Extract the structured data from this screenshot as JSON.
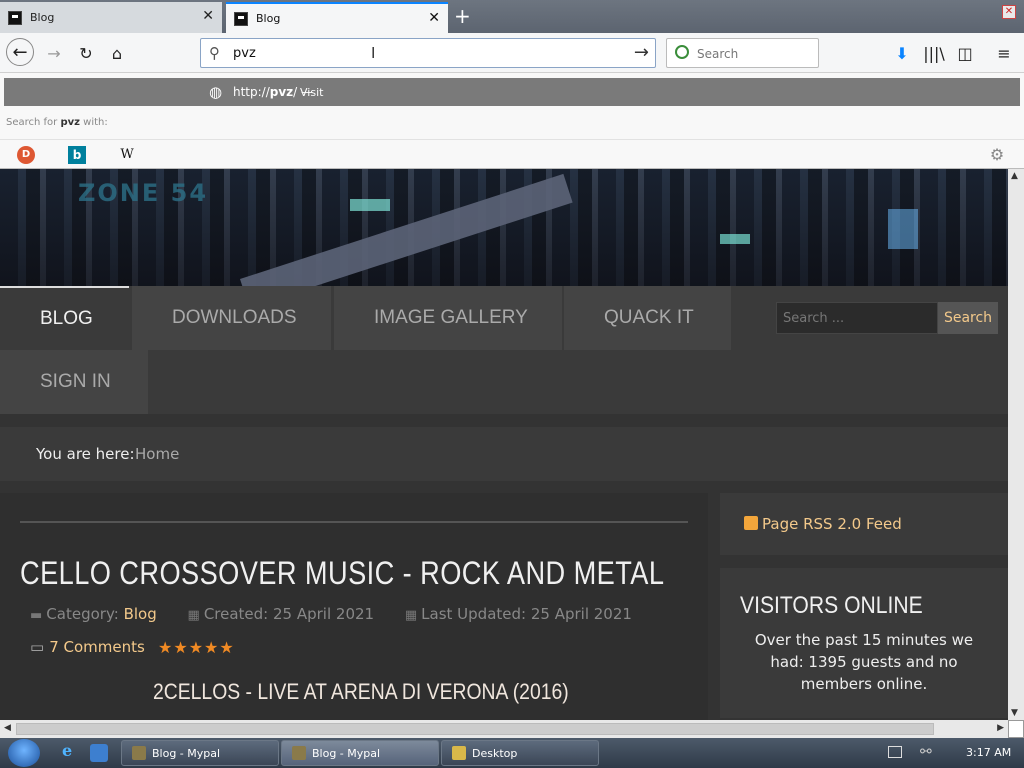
{
  "browser": {
    "tabs": [
      {
        "title": "Blog",
        "close": "✕"
      },
      {
        "title": "Blog",
        "close": "✕"
      }
    ],
    "new_tab": "+",
    "window_close": "✕",
    "nav": {
      "back": "←",
      "forward": "→",
      "reload": "↻",
      "home": "⌂"
    },
    "address": {
      "value": "pvz",
      "go": "→"
    },
    "search": {
      "placeholder": "Search"
    },
    "toolbar": {
      "downloads": "⬇",
      "library": "|||\\",
      "sidebar": "◫",
      "menu": "≡"
    }
  },
  "autocomplete": {
    "visit_url_prefix": "http://",
    "visit_url_host": "pvz",
    "visit_url_suffix": "/",
    "visit_sep": " — ",
    "visit_label": "Visit",
    "search_for_prefix": "Search for",
    "search_term": "pvz",
    "search_for_suffix": "with:",
    "engines": [
      "D",
      "b",
      "W"
    ],
    "settings_icon": "⚙"
  },
  "page": {
    "banner_logo": "ZONE 54",
    "menu": [
      "BLOG",
      "DOWNLOADS",
      "IMAGE GALLERY",
      "QUACK IT",
      "SIGN IN"
    ],
    "site_search_placeholder": "Search ...",
    "site_search_button": "Search",
    "breadcrumb_label": "You are here:",
    "breadcrumb_home": "Home",
    "article": {
      "title": "CELLO CROSSOVER MUSIC - ROCK AND METAL",
      "category_label": "Category:",
      "category": "Blog",
      "created": "Created: 25 April 2021",
      "updated": "Last Updated: 25 April 2021",
      "comments": "7 Comments",
      "rating_stars": 5,
      "subtitle": "2CELLOS - LIVE AT ARENA DI VERONA (2016)"
    },
    "sidebar": {
      "rss": "Page RSS 2.0 Feed",
      "visitors_title": "VISITORS ONLINE",
      "visitors_text": "Over the past 15 minutes we had: 1395 guests and no members online."
    }
  },
  "taskbar": {
    "tasks": [
      "Blog - Mypal",
      "Blog - Mypal",
      "Desktop"
    ],
    "clock": "3:17 AM"
  },
  "colors": {
    "accent": "#f3c98b",
    "star": "#f08a24",
    "tab_highlight": "#0a84ff"
  }
}
